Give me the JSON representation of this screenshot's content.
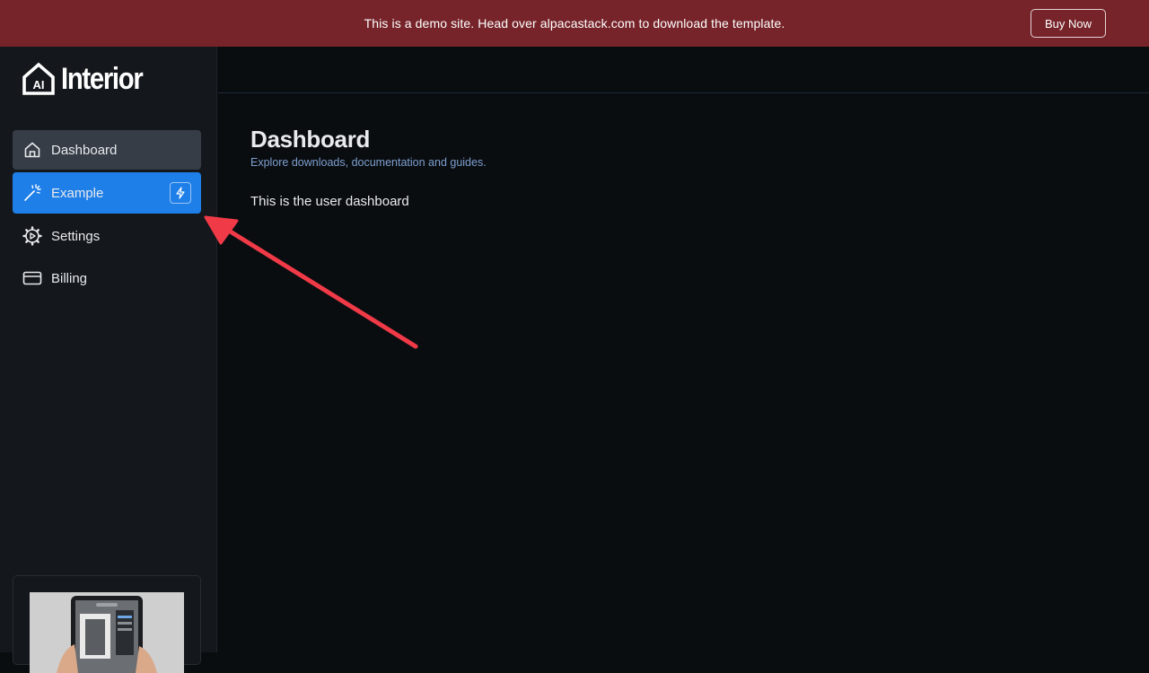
{
  "banner": {
    "text": "This is a demo site. Head over alpacastack.com to download the template.",
    "buy_label": "Buy Now",
    "background": "#76242a"
  },
  "sidebar": {
    "logo": {
      "badge": "AI",
      "text": "Interior"
    },
    "items": [
      {
        "label": "Dashboard",
        "icon": "home-icon",
        "state": "active"
      },
      {
        "label": "Example",
        "icon": "magic-wand-icon",
        "state": "highlighted",
        "badge_icon": "bolt-icon"
      },
      {
        "label": "Settings",
        "icon": "gear-icon",
        "state": "default"
      },
      {
        "label": "Billing",
        "icon": "credit-card-icon",
        "state": "default"
      }
    ],
    "promo_icon": "tablet-preview-image"
  },
  "main": {
    "title": "Dashboard",
    "subtitle": "Explore downloads, documentation and guides.",
    "body": "This is the user dashboard"
  },
  "annotation": {
    "icon": "red-arrow-icon",
    "color": "#f03a47"
  },
  "colors": {
    "accent_blue": "#1f7fe8",
    "sidebar_bg": "#14181c",
    "main_bg": "#0a0d10",
    "subtitle": "#7d9fcf"
  }
}
